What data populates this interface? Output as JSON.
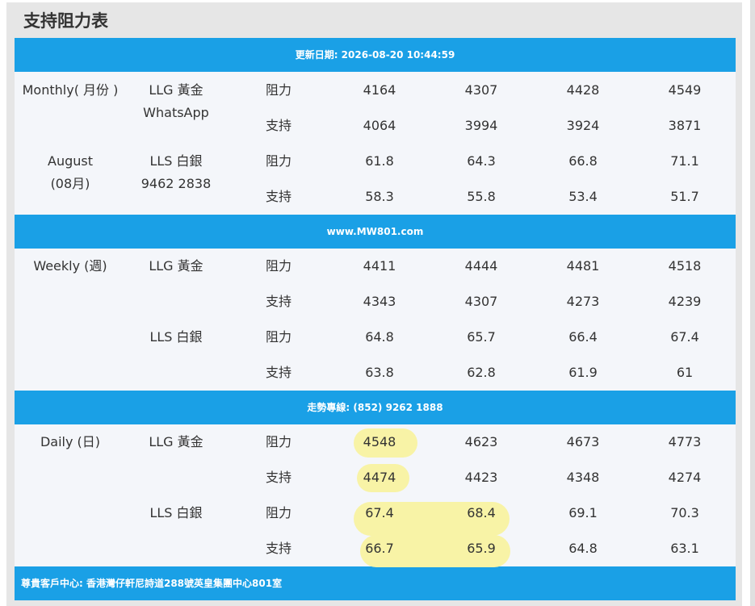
{
  "title": "支持阻力表",
  "banners": {
    "update": "更新日期: 2026-08-20 10:44:59",
    "website": "www.MW801.com",
    "hotline": "走勢專線: (852) 9262 1888",
    "address": "尊貴客戶中心: 香港灣仔軒尼詩道288號英皇集團中心801室"
  },
  "monthly": {
    "period": "Monthly( 月份 )",
    "month_en": "August",
    "month_cn": "(08月)",
    "gold": "LLG 黃金",
    "whatsapp": "WhatsApp",
    "silver": "LLS 白銀",
    "phone": "9462 2838",
    "rows": [
      {
        "label": "阻力",
        "values": [
          "4164",
          "4307",
          "4428",
          "4549"
        ]
      },
      {
        "label": "支持",
        "values": [
          "4064",
          "3994",
          "3924",
          "3871"
        ]
      },
      {
        "label": "阻力",
        "values": [
          "61.8",
          "64.3",
          "66.8",
          "71.1"
        ]
      },
      {
        "label": "支持",
        "values": [
          "58.3",
          "55.8",
          "53.4",
          "51.7"
        ]
      }
    ]
  },
  "weekly": {
    "period": "Weekly  (週)",
    "gold": "LLG 黃金",
    "silver": "LLS 白銀",
    "rows": [
      {
        "label": "阻力",
        "values": [
          "4411",
          "4444",
          "4481",
          "4518"
        ]
      },
      {
        "label": "支持",
        "values": [
          "4343",
          "4307",
          "4273",
          "4239"
        ]
      },
      {
        "label": "阻力",
        "values": [
          "64.8",
          "65.7",
          "66.4",
          "67.4"
        ]
      },
      {
        "label": "支持",
        "values": [
          "63.8",
          "62.8",
          "61.9",
          "61"
        ]
      }
    ]
  },
  "daily": {
    "period": "Daily  (日)",
    "gold": "LLG 黃金",
    "silver": "LLS 白銀",
    "rows": [
      {
        "label": "阻力",
        "values": [
          "4548",
          "4623",
          "4673",
          "4773"
        ]
      },
      {
        "label": "支持",
        "values": [
          "4474",
          "4423",
          "4348",
          "4274"
        ]
      },
      {
        "label": "阻力",
        "values": [
          "67.4",
          "68.4",
          "69.1",
          "70.3"
        ]
      },
      {
        "label": "支持",
        "values": [
          "66.7",
          "65.9",
          "64.8",
          "63.1"
        ]
      }
    ]
  },
  "highlight_color": "#f8f3a6",
  "banner_color": "#1aa0e6"
}
